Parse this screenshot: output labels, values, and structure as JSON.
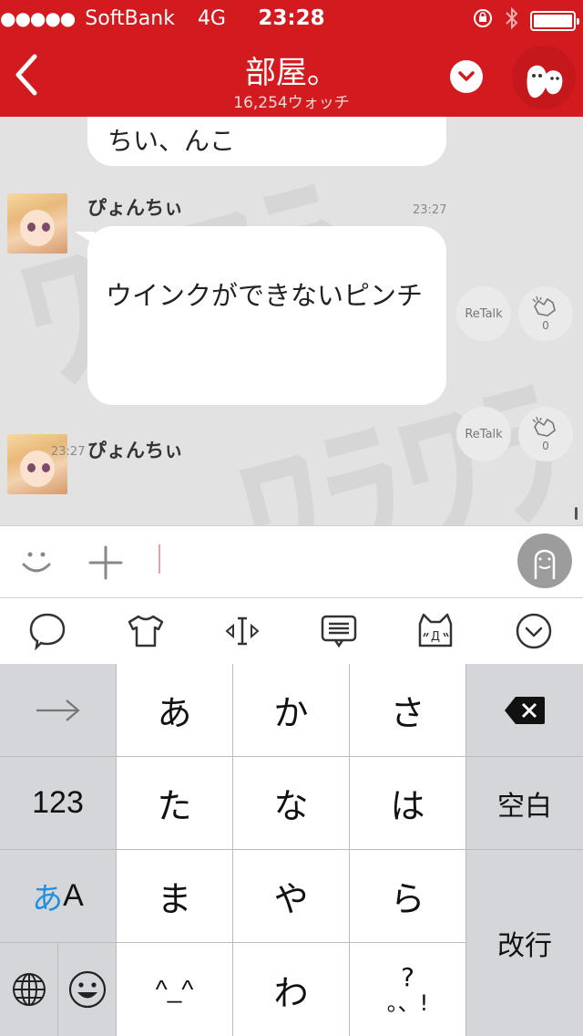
{
  "status_bar": {
    "signal_dots": "●●●●●",
    "carrier": "SoftBank",
    "network": "4G",
    "time": "23:28"
  },
  "header": {
    "title": "部屋。",
    "watch_count": "16,254ウォッチ"
  },
  "chat": {
    "watermark": "ﾜﾗﾜﾗ",
    "previous_message_fragment": "ちい、んこ",
    "messages": [
      {
        "username": "ぴょんちぃ",
        "timestamp": "23:27",
        "text": "ウインクができないピンチ",
        "retalk_label": "ReTalk",
        "clap_count": "0"
      },
      {
        "username": "ぴょんちぃ",
        "timestamp": "23:27",
        "retalk_label": "ReTalk",
        "clap_count": "0"
      }
    ]
  },
  "keyboard": {
    "keys": {
      "a": "あ",
      "ka": "か",
      "sa": "さ",
      "num": "123",
      "ta": "た",
      "na": "な",
      "ha": "は",
      "space": "空白",
      "mode_kana": "あ",
      "mode_alpha": "A",
      "ma": "ま",
      "ya": "や",
      "ra": "ら",
      "enter": "改行",
      "kaomoji": "^_^",
      "wa": "わ",
      "punct_top": "?",
      "punct_bottom": "。、!"
    }
  },
  "colors": {
    "header_red": "#d21a1f",
    "kana_mode_blue": "#1f8fe0"
  }
}
